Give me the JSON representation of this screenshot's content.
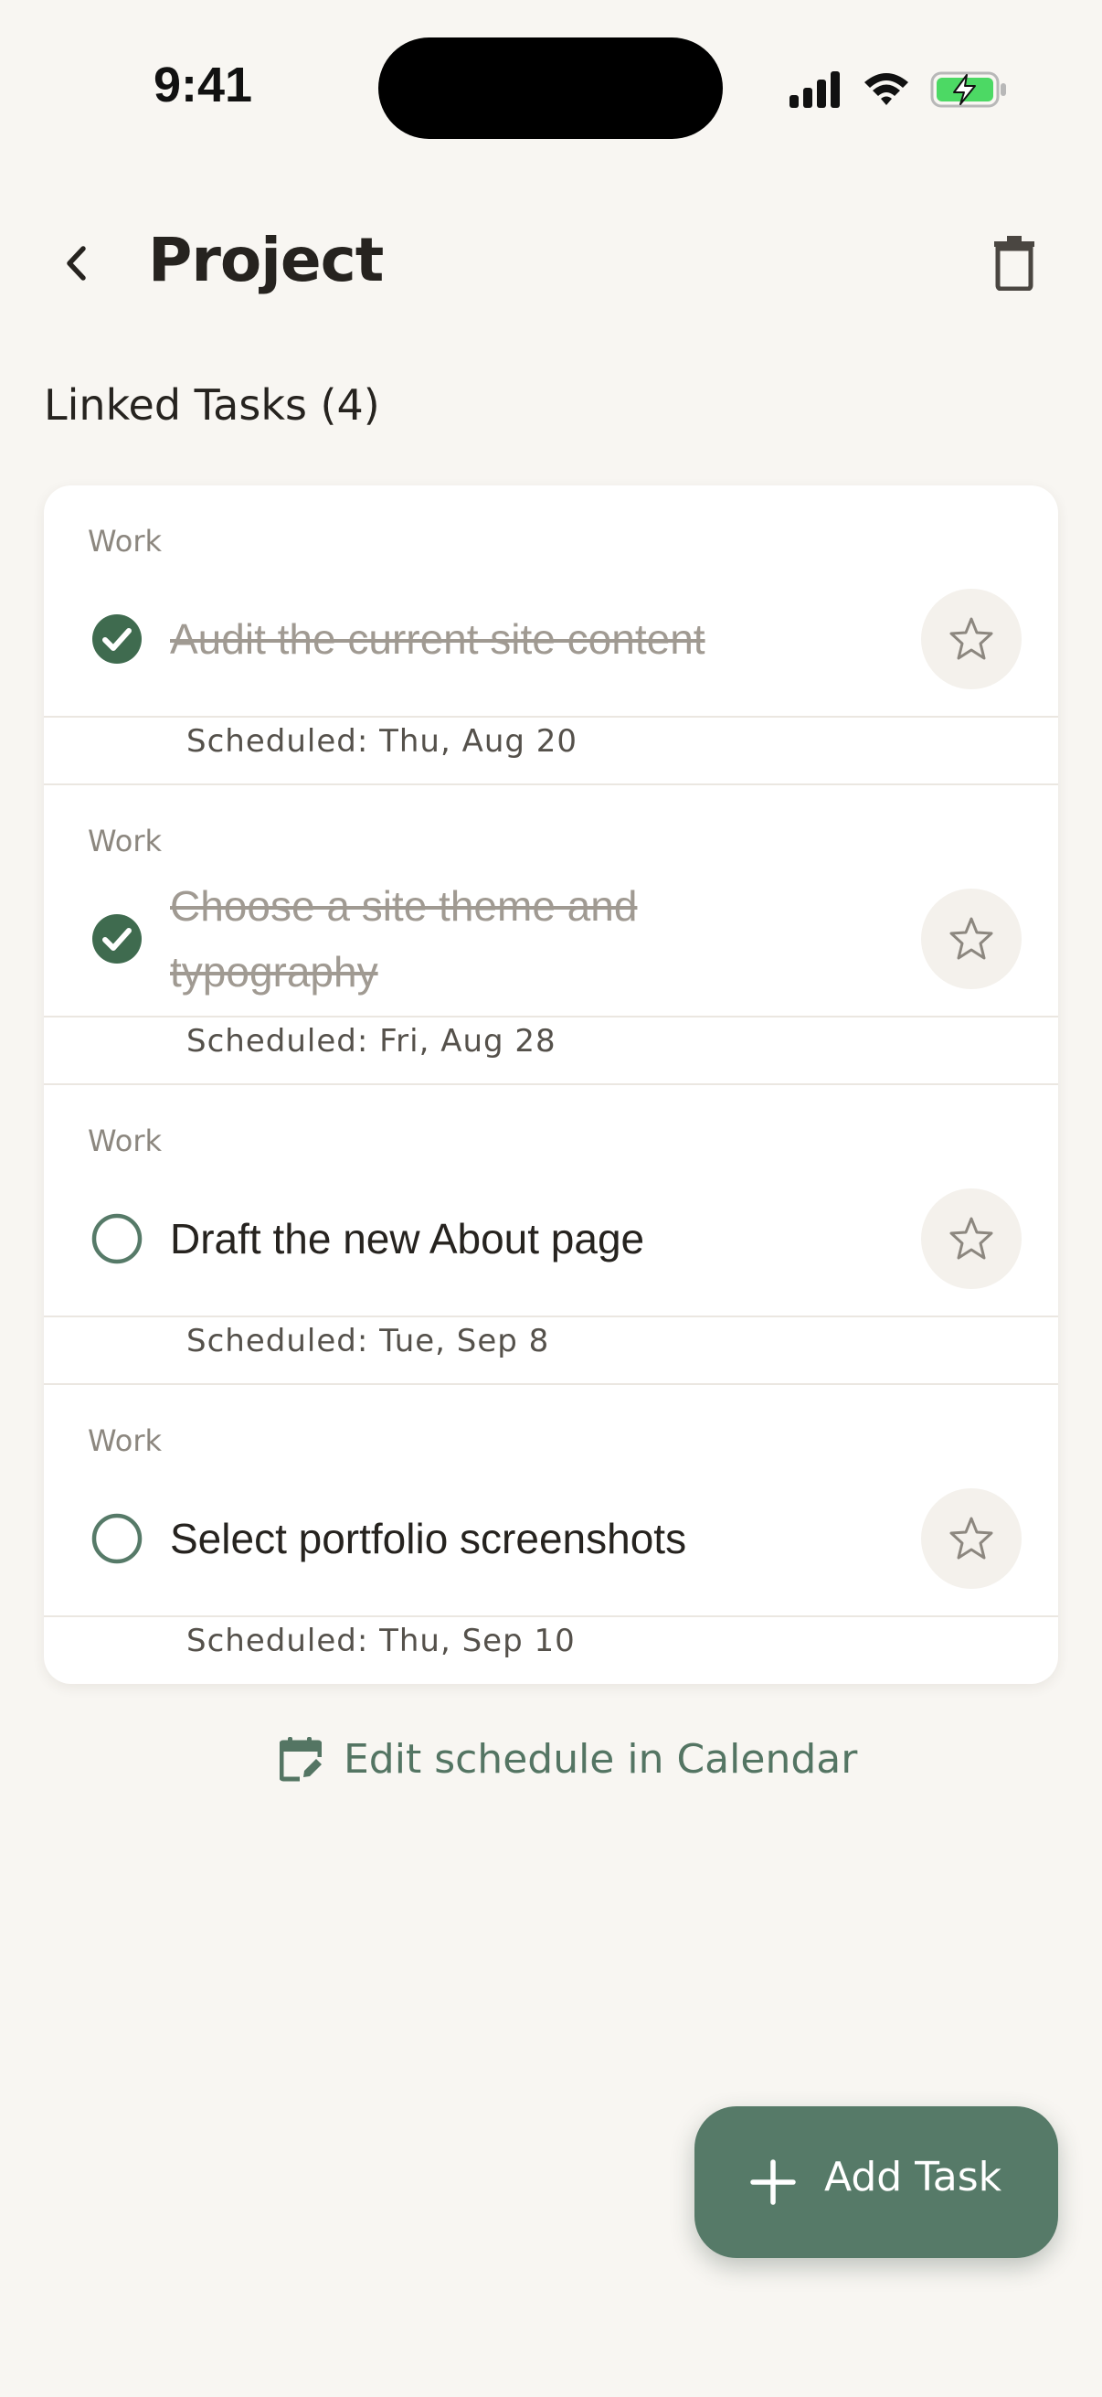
{
  "status_bar": {
    "time": "9:41"
  },
  "header": {
    "title": "Project",
    "back_icon": "chevron-left-icon",
    "delete_icon": "trash-icon"
  },
  "section": {
    "title": "Linked Tasks (4)"
  },
  "tasks": [
    {
      "category": "Work",
      "title": "Audit the current site content",
      "completed": true,
      "schedule": "Scheduled: Thu, Aug 20"
    },
    {
      "category": "Work",
      "title": "Choose a site theme and typography",
      "completed": true,
      "schedule": "Scheduled: Fri, Aug 28"
    },
    {
      "category": "Work",
      "title": "Draft the new About page",
      "completed": false,
      "schedule": "Scheduled: Tue, Sep 8"
    },
    {
      "category": "Work",
      "title": "Select portfolio screenshots",
      "completed": false,
      "schedule": "Scheduled: Thu, Sep 10"
    }
  ],
  "calendar_link": {
    "label": "Edit schedule in Calendar",
    "icon": "calendar-edit-icon"
  },
  "fab": {
    "label": "Add Task",
    "icon": "plus-icon"
  },
  "colors": {
    "accent": "#567a68",
    "check_done": "#3f6b4f",
    "background": "#f8f6f2"
  }
}
